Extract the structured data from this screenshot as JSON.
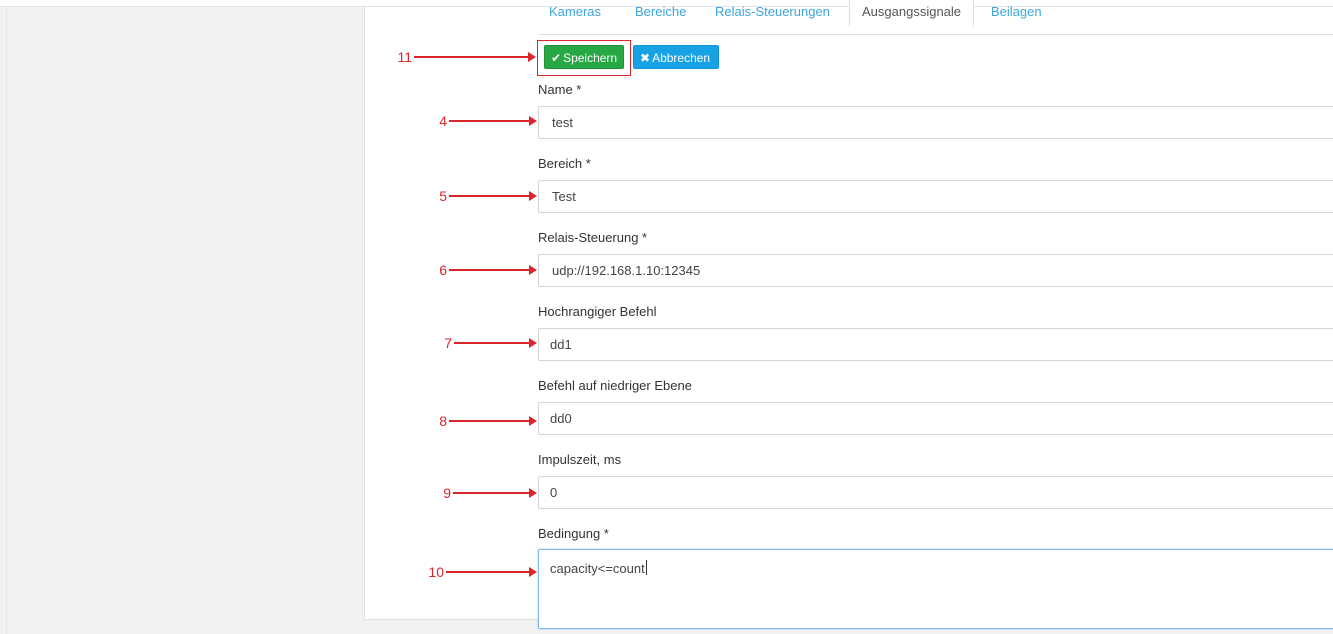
{
  "tabs": [
    {
      "label": "Kameras"
    },
    {
      "label": "Bereiche"
    },
    {
      "label": "Relais-Steuerungen"
    },
    {
      "label": "Ausgangssignale",
      "active": true
    },
    {
      "label": "Beilagen"
    }
  ],
  "toolbar": {
    "save_label": "Speichern",
    "save_icon": "check-icon",
    "cancel_label": "Abbrechen",
    "cancel_icon": "close-icon"
  },
  "form": {
    "name": {
      "label": "Name *",
      "value": "test"
    },
    "bereich": {
      "label": "Bereich *",
      "value": "Test"
    },
    "relais": {
      "label": "Relais-Steuerung *",
      "value": "udp://192.168.1.10:12345"
    },
    "hoch": {
      "label": "Hochrangiger Befehl",
      "value": "dd1"
    },
    "nieder": {
      "label": "Befehl auf niedriger Ebene",
      "value": "dd0"
    },
    "impuls": {
      "label": "Impulszeit, ms",
      "value": "0"
    },
    "bedingung": {
      "label": "Bedingung *",
      "value": "capacity<=count"
    }
  },
  "annotations": {
    "a11": "11",
    "a4": "4",
    "a5": "5",
    "a6": "6",
    "a7": "7",
    "a8": "8",
    "a9": "9",
    "a10": "10"
  },
  "colors": {
    "accent_red": "#d9262c",
    "save_green": "#27a844",
    "cancel_blue": "#17a2e6",
    "tab_link": "#3ca6dc"
  }
}
